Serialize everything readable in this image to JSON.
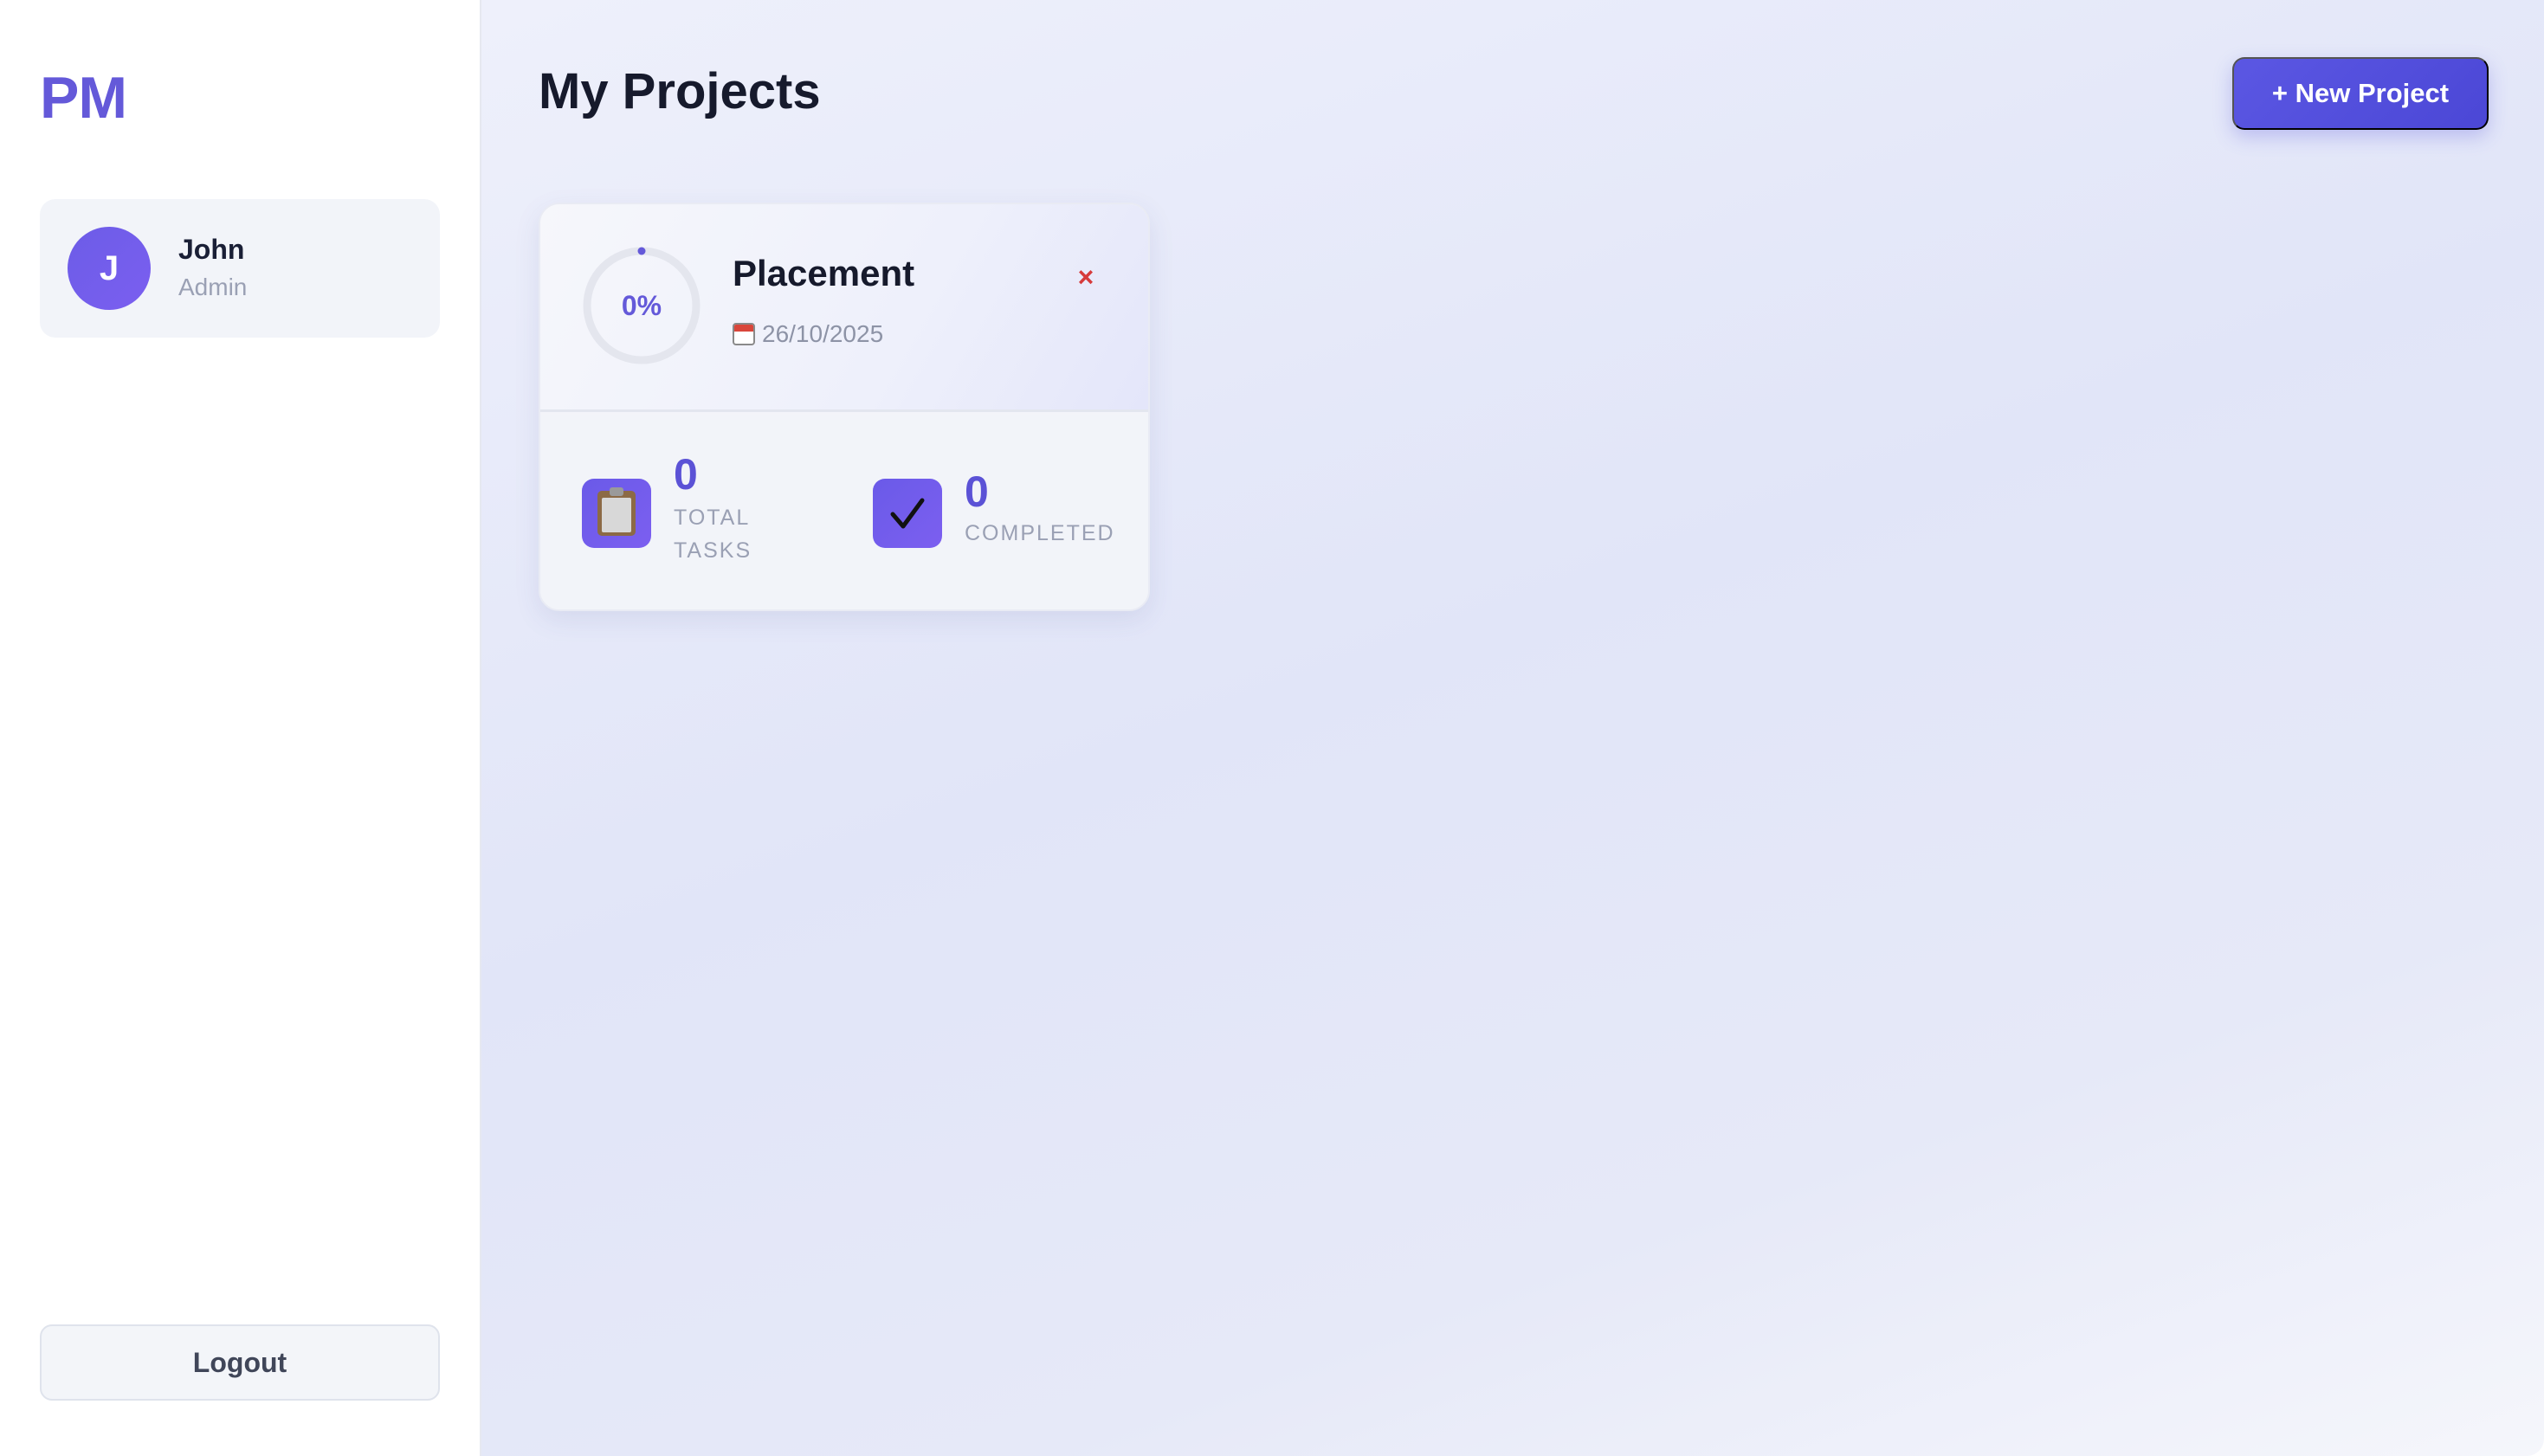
{
  "sidebar": {
    "logo": "PM",
    "user": {
      "initial": "J",
      "name": "John",
      "role": "Admin"
    },
    "logout_label": "Logout"
  },
  "header": {
    "title": "My Projects",
    "new_project_label": "+ New Project"
  },
  "projects": [
    {
      "name": "Placement",
      "date": "26/10/2025",
      "progress_label": "0%",
      "progress_fraction": 0,
      "delete_label": "×",
      "stats": {
        "total_tasks": {
          "value": "0",
          "label": "TOTAL TASKS"
        },
        "completed": {
          "value": "0",
          "label": "COMPLETED"
        }
      }
    }
  ],
  "colors": {
    "accent": "#6459d9",
    "button": "#5b57e3",
    "danger": "#d63b3b"
  },
  "icons": {
    "calendar": "calendar-icon",
    "clipboard": "clipboard-icon",
    "check": "check-icon",
    "close": "close-icon"
  }
}
